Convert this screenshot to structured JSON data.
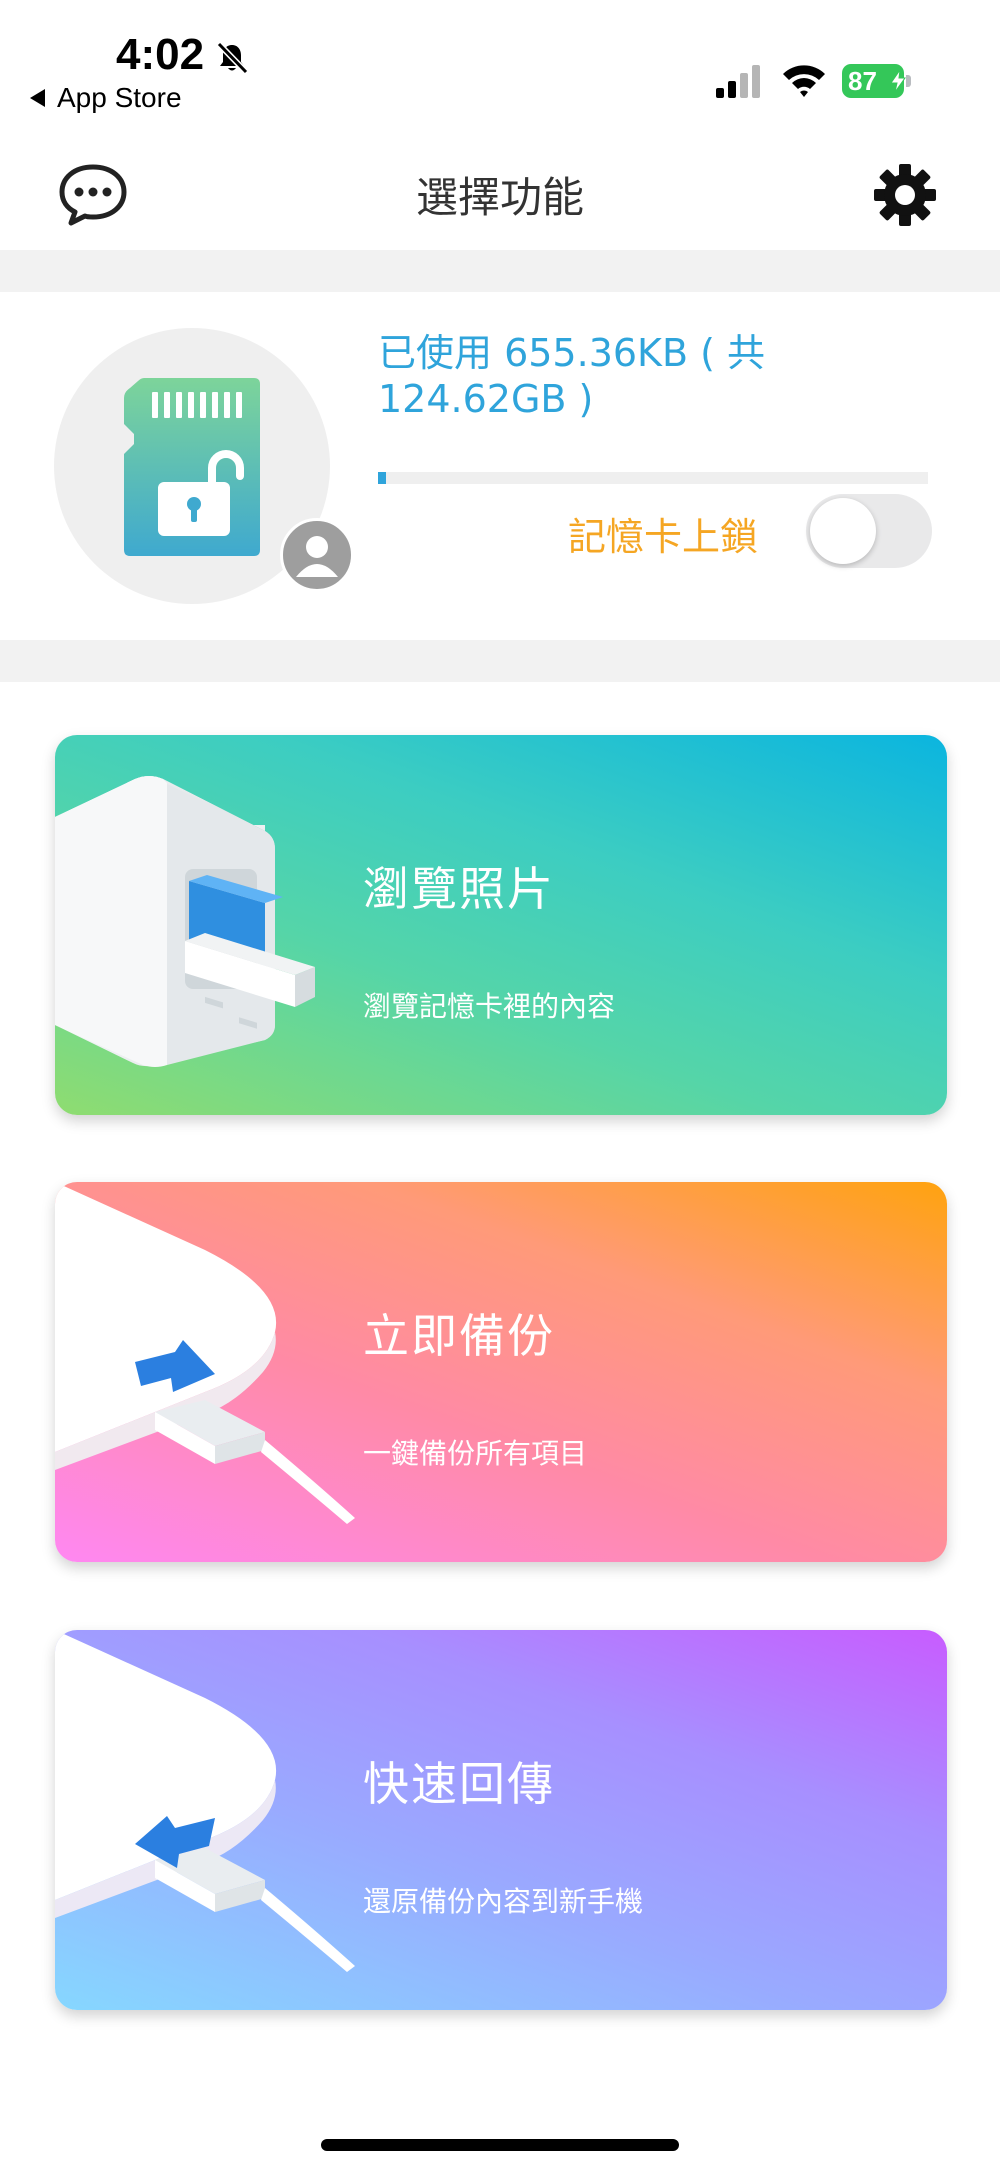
{
  "status_bar": {
    "time": "4:02",
    "back_app": "App Store",
    "battery": "87"
  },
  "nav": {
    "title": "選擇功能"
  },
  "storage": {
    "used_text": "已使用 655.36KB ( 共 124.62GB )",
    "used_fraction": 0.015,
    "lock_label": "記憶卡上鎖",
    "lock_enabled": false
  },
  "cards": [
    {
      "title": "瀏覽照片",
      "subtitle": "瀏覽記憶卡裡的內容"
    },
    {
      "title": "立即備份",
      "subtitle": "一鍵備份所有項目"
    },
    {
      "title": "快速回傳",
      "subtitle": "還原備份內容到新手機"
    }
  ],
  "colors": {
    "accent_blue": "#2fa4db",
    "accent_orange": "#f5a623",
    "battery_green": "#34c759"
  }
}
